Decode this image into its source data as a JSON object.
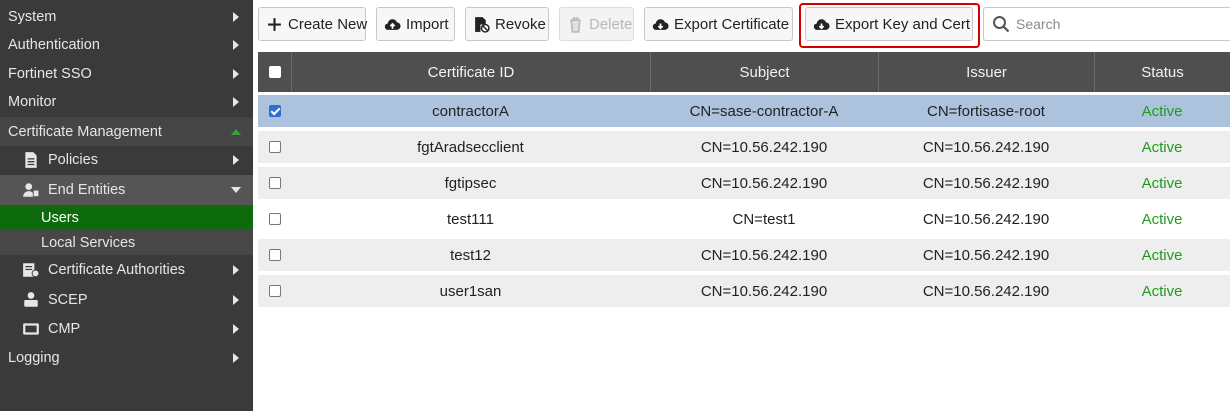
{
  "sidebar": {
    "items": [
      {
        "label": "System"
      },
      {
        "label": "Authentication"
      },
      {
        "label": "Fortinet SSO"
      },
      {
        "label": "Monitor"
      },
      {
        "label": "Certificate Management"
      },
      {
        "label": "Policies"
      },
      {
        "label": "End Entities"
      },
      {
        "label": "Users"
      },
      {
        "label": "Local Services"
      },
      {
        "label": "Certificate Authorities"
      },
      {
        "label": "SCEP"
      },
      {
        "label": "CMP"
      },
      {
        "label": "Logging"
      }
    ]
  },
  "toolbar": {
    "create_new": "Create New",
    "import": "Import",
    "revoke": "Revoke",
    "delete": "Delete",
    "export_certificate": "Export Certificate",
    "export_key_and_cert": "Export Key and Cert",
    "search_placeholder": "Search"
  },
  "table": {
    "headers": [
      "Certificate ID",
      "Subject",
      "Issuer",
      "Status"
    ],
    "rows": [
      {
        "id": "contractorA",
        "subject": "CN=sase-contractor-A",
        "issuer": "CN=fortisase-root",
        "status": "Active",
        "checked": true
      },
      {
        "id": "fgtAradsecclient",
        "subject": "CN=10.56.242.190",
        "issuer": "CN=10.56.242.190",
        "status": "Active",
        "checked": false
      },
      {
        "id": "fgtipsec",
        "subject": "CN=10.56.242.190",
        "issuer": "CN=10.56.242.190",
        "status": "Active",
        "checked": false
      },
      {
        "id": "test111",
        "subject": "CN=test1",
        "issuer": "CN=10.56.242.190",
        "status": "Active",
        "checked": false
      },
      {
        "id": "test12",
        "subject": "CN=10.56.242.190",
        "issuer": "CN=10.56.242.190",
        "status": "Active",
        "checked": false
      },
      {
        "id": "user1san",
        "subject": "CN=10.56.242.190",
        "issuer": "CN=10.56.242.190",
        "status": "Active",
        "checked": false
      }
    ]
  },
  "colors": {
    "sidebar_bg": "#3a3a3a",
    "selected_nav": "#0d6b0d",
    "selected_row": "#adc3dd",
    "status_active": "#1f9b1f",
    "highlight_border": "#d40000"
  }
}
